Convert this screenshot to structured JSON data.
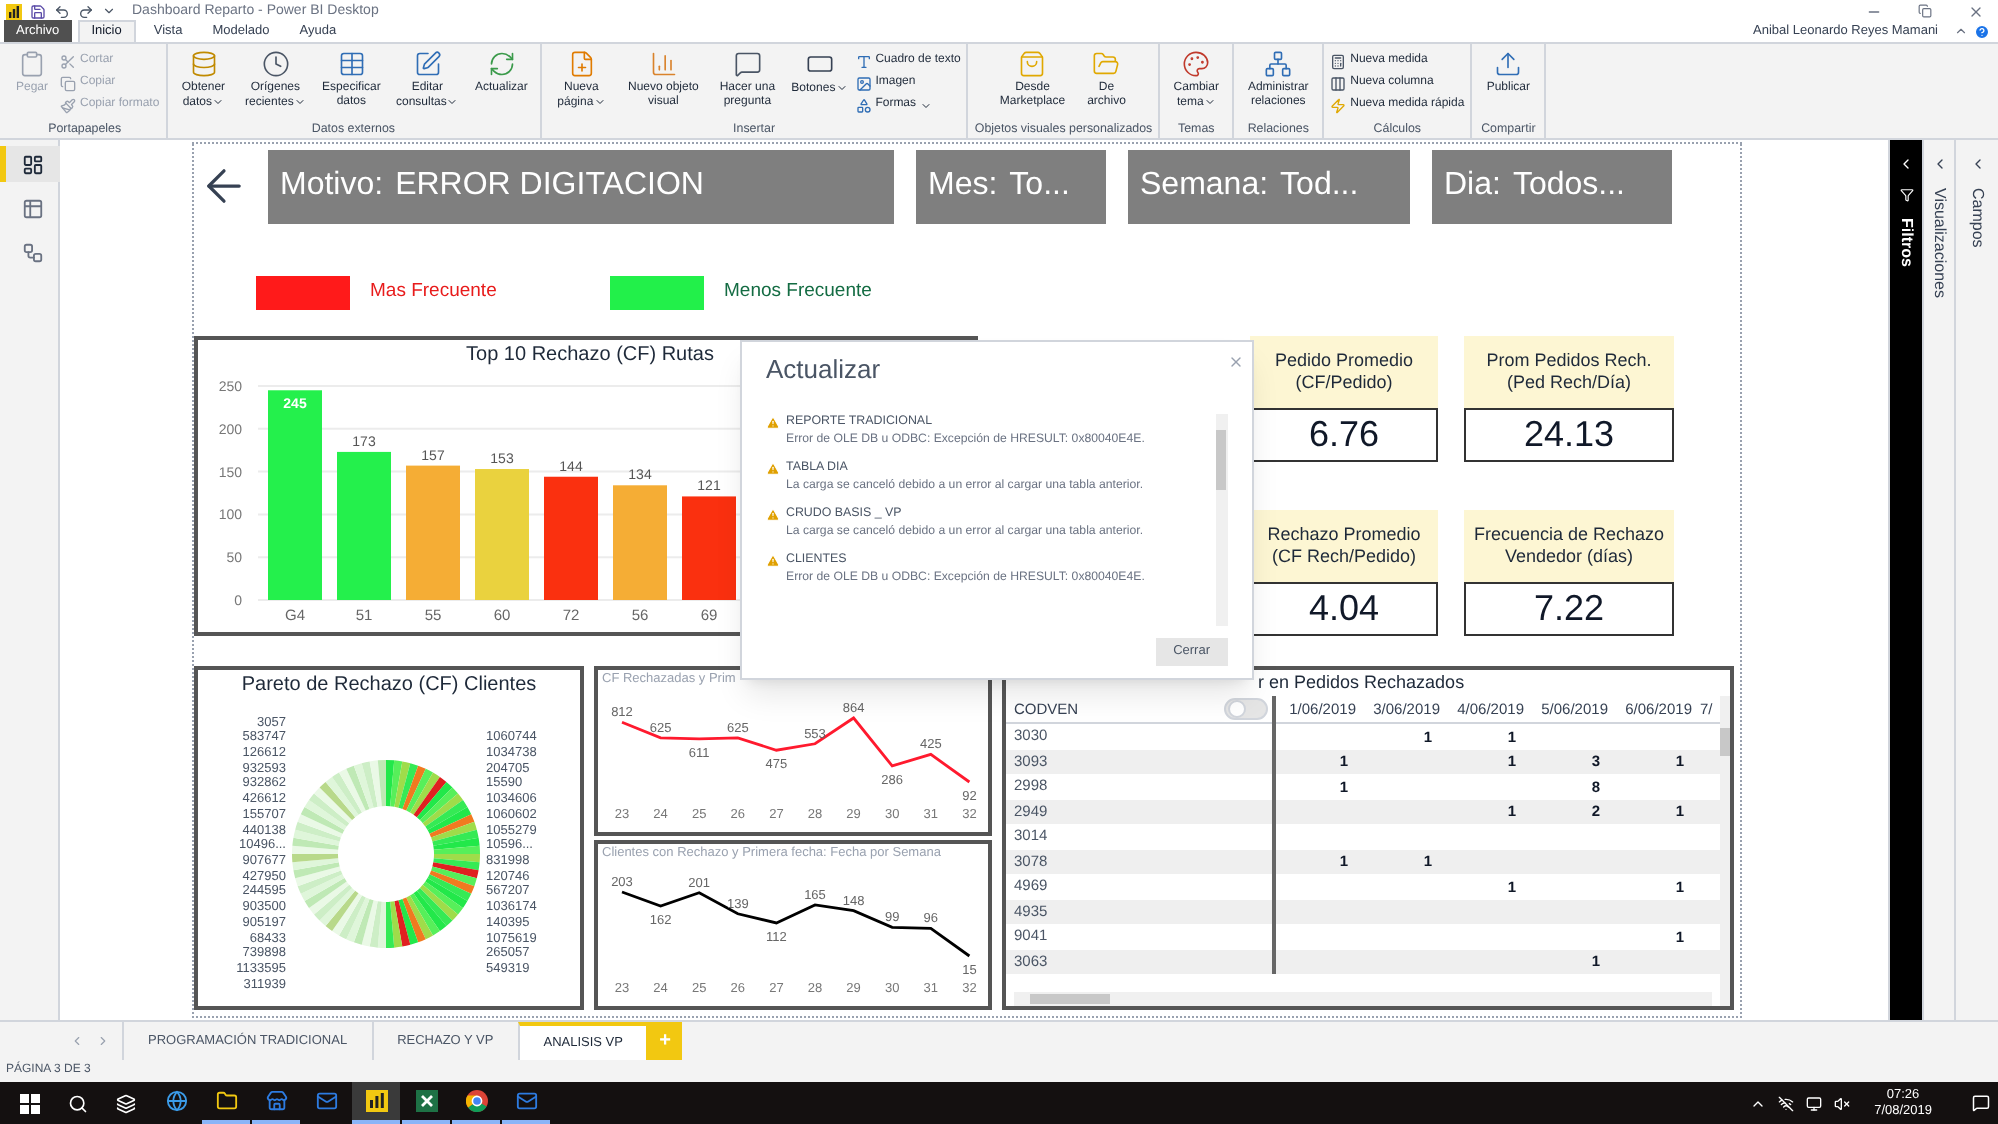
{
  "window": {
    "title": "Dashboard Reparto - Power BI Desktop",
    "user": "Anibal Leonardo Reyes Mamani"
  },
  "menu_tabs": [
    {
      "label": "Archivo",
      "kind": "file",
      "selected": false
    },
    {
      "label": "Inicio",
      "kind": "tab",
      "selected": true
    },
    {
      "label": "Vista",
      "kind": "tab",
      "selected": false
    },
    {
      "label": "Modelado",
      "kind": "tab",
      "selected": false
    },
    {
      "label": "Ayuda",
      "kind": "tab",
      "selected": false
    }
  ],
  "ribbon": [
    {
      "group": "Portapapeles",
      "items": [
        {
          "label": "Pegar",
          "kind": "large",
          "disabled": true,
          "dropdown": false
        },
        {
          "label": "Cortar",
          "kind": "small",
          "disabled": true,
          "dropdown": false
        },
        {
          "label": "Copiar",
          "kind": "small",
          "disabled": true,
          "dropdown": false
        },
        {
          "label": "Copiar formato",
          "kind": "small",
          "disabled": true,
          "dropdown": false
        }
      ]
    },
    {
      "group": "Datos externos",
      "items": [
        {
          "label": "Obtener datos",
          "kind": "large",
          "disabled": false,
          "dropdown": true
        },
        {
          "label": "Orígenes recientes",
          "kind": "large",
          "disabled": false,
          "dropdown": true
        },
        {
          "label": "Especificar datos",
          "kind": "large",
          "disabled": false,
          "dropdown": false
        },
        {
          "label": "Editar consultas",
          "kind": "large",
          "disabled": false,
          "dropdown": true
        },
        {
          "label": "Actualizar",
          "kind": "large",
          "disabled": false,
          "dropdown": false
        }
      ]
    },
    {
      "group": "Insertar",
      "items": [
        {
          "label": "Nueva página",
          "kind": "large",
          "disabled": false,
          "dropdown": true
        },
        {
          "label": "Nuevo objeto visual",
          "kind": "large",
          "disabled": false,
          "dropdown": false
        },
        {
          "label": "Hacer una pregunta",
          "kind": "large",
          "disabled": false,
          "dropdown": false
        },
        {
          "label": "Botones",
          "kind": "large",
          "disabled": false,
          "dropdown": true
        },
        {
          "label": "Cuadro de texto",
          "kind": "small",
          "disabled": false,
          "dropdown": false
        },
        {
          "label": "Imagen",
          "kind": "small",
          "disabled": false,
          "dropdown": false
        },
        {
          "label": "Formas",
          "kind": "small",
          "disabled": false,
          "dropdown": true
        }
      ]
    },
    {
      "group": "Objetos visuales personalizados",
      "items": [
        {
          "label": "Desde Marketplace",
          "kind": "large",
          "disabled": false,
          "dropdown": false
        },
        {
          "label": "De archivo",
          "kind": "large",
          "disabled": false,
          "dropdown": false
        }
      ]
    },
    {
      "group": "Temas",
      "items": [
        {
          "label": "Cambiar tema",
          "kind": "large",
          "disabled": false,
          "dropdown": true
        }
      ]
    },
    {
      "group": "Relaciones",
      "items": [
        {
          "label": "Administrar relaciones",
          "kind": "large",
          "disabled": false,
          "dropdown": false
        }
      ]
    },
    {
      "group": "Cálculos",
      "items": [
        {
          "label": "Nueva medida",
          "kind": "small",
          "disabled": false,
          "dropdown": false
        },
        {
          "label": "Nueva columna",
          "kind": "small",
          "disabled": false,
          "dropdown": false
        },
        {
          "label": "Nueva medida rápida",
          "kind": "small",
          "disabled": false,
          "dropdown": false
        }
      ]
    },
    {
      "group": "Compartir",
      "items": [
        {
          "label": "Publicar",
          "kind": "large",
          "disabled": false,
          "dropdown": false
        }
      ]
    }
  ],
  "left_nav": [
    {
      "selected": true
    },
    {
      "selected": false
    },
    {
      "selected": false
    }
  ],
  "slicers": [
    {
      "field": "Motivo:",
      "value": "ERROR DIGITACION"
    },
    {
      "field": "Mes:",
      "value": "To..."
    },
    {
      "field": "Semana:",
      "value": "Tod..."
    },
    {
      "field": "Dia:",
      "value": "Todos..."
    }
  ],
  "legend": [
    {
      "label": "Mas Frecuente",
      "color": "#ff1a1a"
    },
    {
      "label": "Menos Frecuente",
      "color": "#22f04a"
    }
  ],
  "bar_chart": {
    "chart_data": {
      "type": "bar",
      "title": "Top 10 Rechazo (CF) Rutas",
      "categories": [
        "G4",
        "51",
        "55",
        "60",
        "72",
        "56",
        "69"
      ],
      "series": [
        {
          "color": "#24f04c",
          "values": [
            245,
            173,
            null,
            null,
            null,
            null,
            null
          ]
        },
        {
          "color": "#f5ad35",
          "values": [
            null,
            null,
            157,
            null,
            null,
            134,
            null
          ]
        },
        {
          "color": "#ead23e",
          "values": [
            null,
            null,
            null,
            153,
            null,
            null,
            null
          ]
        },
        {
          "color": "#fa300f",
          "values": [
            null,
            null,
            null,
            null,
            144,
            null,
            121
          ]
        }
      ],
      "stacked": true,
      "grid": true,
      "ylim": [
        0,
        250
      ],
      "yticks": [
        0,
        50,
        100,
        150,
        200,
        250
      ],
      "data_labels": true
    }
  },
  "kpi_cards": [
    {
      "label": "Pedido Promedio (CF/Pedido)",
      "value": "6.76"
    },
    {
      "label": "Prom Pedidos Rech. (Ped Rech/Día)",
      "value": "24.13"
    },
    {
      "label": "Rechazo Promedio (CF Rech/Pedido)",
      "value": "4.04"
    },
    {
      "label": "Frecuencia de Rechazo Vendedor (días)",
      "value": "7.22"
    }
  ],
  "dialog": {
    "title": "Actualizar",
    "entries": [
      {
        "name": "REPORTE TRADICIONAL",
        "message": "Error de OLE DB u ODBC: Excepción de HRESULT: 0x80040E4E."
      },
      {
        "name": "TABLA DIA",
        "message": "La carga se canceló debido a un error al cargar una tabla anterior."
      },
      {
        "name": "CRUDO BASIS _ VP",
        "message": "La carga se canceló debido a un error al cargar una tabla anterior."
      },
      {
        "name": "CLIENTES",
        "message": "Error de OLE DB u ODBC: Excepción de HRESULT: 0x80040E4E."
      }
    ],
    "button": "Cerrar"
  },
  "pareto": {
    "title": "Pareto de Rechazo (CF) Clientes",
    "left_labels": [
      "3057",
      "583747",
      "126612",
      "932593",
      "932862",
      "426612",
      "155707",
      "440138",
      "10496...",
      "907677",
      "427950",
      "244595",
      "903500",
      "905197",
      "68433",
      "739898",
      "1133595",
      "311939"
    ],
    "right_labels": [
      "1060744",
      "1034738",
      "204705",
      "15590",
      "1034606",
      "1060602",
      "1055279",
      "10596...",
      "831998",
      "120746",
      "567207",
      "1036174",
      "140395",
      "1075619",
      "265057",
      "549319"
    ]
  },
  "line_charts": [
    {
      "chart_data": {
        "type": "line",
        "title": "CF Rechazadas y Prim",
        "categories": [
          "23",
          "24",
          "25",
          "26",
          "27",
          "28",
          "29",
          "30",
          "31",
          "32"
        ],
        "series": [
          {
            "color": "#ff1a2e",
            "values": [
              812,
              625,
              611,
              625,
              475,
              553,
              864,
              286,
              425,
              92
            ]
          }
        ],
        "data_labels": true
      }
    },
    {
      "chart_data": {
        "type": "line",
        "title": "Clientes con Rechazo y Primera fecha: Fecha por Semana",
        "categories": [
          "23",
          "24",
          "25",
          "26",
          "27",
          "28",
          "29",
          "30",
          "31",
          "32"
        ],
        "series": [
          {
            "color": "#000000",
            "values": [
              203,
              162,
              201,
              139,
              112,
              165,
              148,
              99,
              96,
              15
            ]
          }
        ],
        "data_labels": true
      }
    }
  ],
  "matrix": {
    "title": "r en Pedidos Rechazados",
    "first_column": "CODVEN",
    "toggle": {
      "on": false
    },
    "columns": [
      "1/06/2019",
      "3/06/2019",
      "4/06/2019",
      "5/06/2019",
      "6/06/2019",
      "7/"
    ],
    "rows": [
      {
        "codven": "3030",
        "cells": [
          {
            "blank": true
          },
          {
            "blank": false,
            "value": "1"
          },
          {
            "blank": false,
            "value": "1"
          },
          {
            "blank": true
          },
          {
            "blank": true
          }
        ]
      },
      {
        "codven": "3093",
        "cells": [
          {
            "blank": false,
            "value": "1"
          },
          {
            "blank": true
          },
          {
            "blank": false,
            "value": "1"
          },
          {
            "blank": false,
            "value": "3"
          },
          {
            "blank": false,
            "value": "1"
          }
        ]
      },
      {
        "codven": "2998",
        "cells": [
          {
            "blank": false,
            "value": "1"
          },
          {
            "blank": true
          },
          {
            "blank": true
          },
          {
            "blank": false,
            "value": "8"
          },
          {
            "blank": true
          }
        ]
      },
      {
        "codven": "2949",
        "cells": [
          {
            "blank": true
          },
          {
            "blank": true
          },
          {
            "blank": false,
            "value": "1"
          },
          {
            "blank": false,
            "value": "2"
          },
          {
            "blank": false,
            "value": "1"
          }
        ]
      },
      {
        "codven": "3014",
        "cells": [
          {
            "blank": true
          },
          {
            "blank": true
          },
          {
            "blank": true
          },
          {
            "blank": true
          },
          {
            "blank": true
          }
        ]
      },
      {
        "codven": "3078",
        "cells": [
          {
            "blank": false,
            "value": "1"
          },
          {
            "blank": false,
            "value": "1"
          },
          {
            "blank": true
          },
          {
            "blank": true
          },
          {
            "blank": true
          }
        ]
      },
      {
        "codven": "4969",
        "cells": [
          {
            "blank": true
          },
          {
            "blank": true
          },
          {
            "blank": false,
            "value": "1"
          },
          {
            "blank": true
          },
          {
            "blank": false,
            "value": "1"
          }
        ]
      },
      {
        "codven": "4935",
        "cells": [
          {
            "blank": true
          },
          {
            "blank": true
          },
          {
            "blank": true
          },
          {
            "blank": true
          },
          {
            "blank": true
          }
        ]
      },
      {
        "codven": "9041",
        "cells": [
          {
            "blank": true
          },
          {
            "blank": true
          },
          {
            "blank": true
          },
          {
            "blank": true
          },
          {
            "blank": false,
            "value": "1"
          }
        ]
      },
      {
        "codven": "3063",
        "cells": [
          {
            "blank": true
          },
          {
            "blank": true
          },
          {
            "blank": true
          },
          {
            "blank": false,
            "value": "1"
          },
          {
            "blank": true
          }
        ]
      }
    ]
  },
  "panes": [
    {
      "label": "Filtros",
      "kind": "filters"
    },
    {
      "label": "Visualizaciones",
      "kind": "plain"
    },
    {
      "label": "Campos",
      "kind": "plain"
    }
  ],
  "page_tabs": [
    {
      "label": "PROGRAMACIÓN TRADICIONAL",
      "selected": false
    },
    {
      "label": "RECHAZO Y VP",
      "selected": false
    },
    {
      "label": "ANALISIS VP",
      "selected": true
    }
  ],
  "add_page": "+",
  "status_bar": "PÁGINA 3 DE 3",
  "taskbar": {
    "apps": [
      {
        "running": false,
        "selected": false
      },
      {
        "running": true,
        "selected": false
      },
      {
        "running": true,
        "selected": false
      },
      {
        "running": false,
        "selected": false
      },
      {
        "running": true,
        "selected": true
      },
      {
        "running": true,
        "selected": false
      },
      {
        "running": true,
        "selected": false
      },
      {
        "running": true,
        "selected": false
      }
    ],
    "time": "07:26",
    "date": "7/08/2019"
  }
}
